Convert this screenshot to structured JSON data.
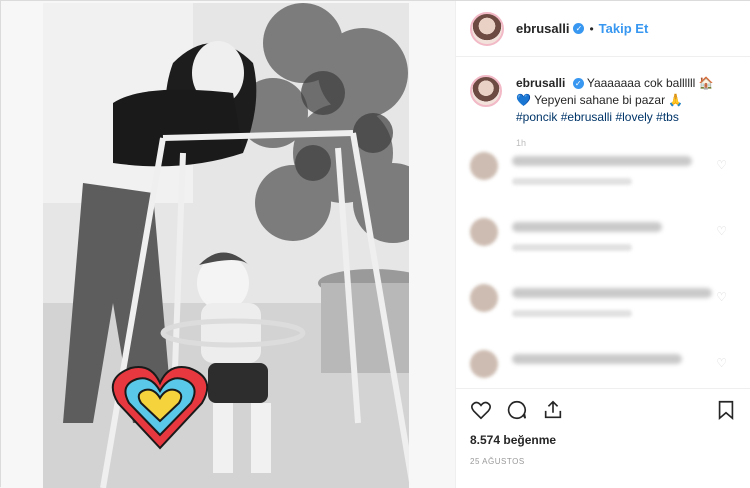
{
  "header": {
    "username": "ebrusalli",
    "follow_label": "Takip Et",
    "separator": "•"
  },
  "caption": {
    "username": "ebrusalli",
    "text_line1": "Yaaaaaaa cok ballllll",
    "text_line2": "Yepyeni sahane bi pazar",
    "hashtags": [
      "#poncik",
      "#ebrusalli",
      "#lovely",
      "#tbs"
    ],
    "time": "1h"
  },
  "comments": [
    {
      "blurred": true
    },
    {
      "blurred": true
    },
    {
      "blurred": true
    },
    {
      "blurred": true
    }
  ],
  "actions": {
    "likes": "8.574 beğenme",
    "date": "25 AĞUSTOS"
  },
  "icons": {
    "like": "heart-outline-icon",
    "comment": "comment-bubble-icon",
    "share": "share-upload-icon",
    "save": "bookmark-icon",
    "verified": "verified-badge-icon"
  },
  "colors": {
    "accent": "#3897f0",
    "text": "#262626",
    "hashtag": "#003569",
    "sticker_red": "#e8383f",
    "sticker_blue": "#5ac8e8",
    "sticker_yellow": "#f4d33c"
  }
}
